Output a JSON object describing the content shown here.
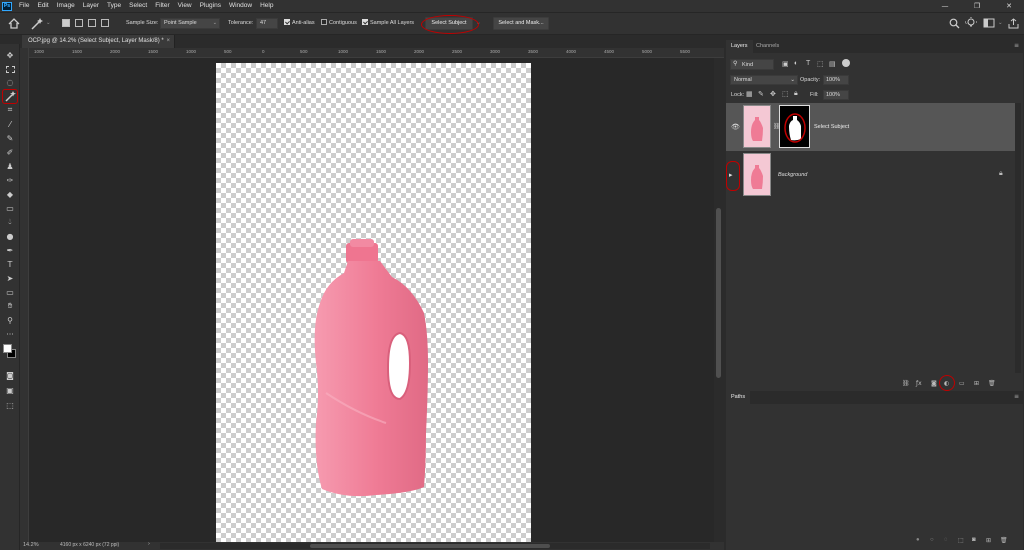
{
  "app": {
    "logo": "Ps"
  },
  "menu": [
    "File",
    "Edit",
    "Image",
    "Layer",
    "Type",
    "Select",
    "Filter",
    "View",
    "Plugins",
    "Window",
    "Help"
  ],
  "window_controls": {
    "minimize": "—",
    "restore": "❐",
    "close": "✕"
  },
  "options": {
    "sample_size_label": "Sample Size:",
    "sample_size_value": "Point Sample",
    "tolerance_label": "Tolerance:",
    "tolerance_value": "47",
    "anti_alias_label": "Anti-alias",
    "anti_alias_checked": true,
    "contiguous_label": "Contiguous",
    "contiguous_checked": false,
    "sample_all_layers_label": "Sample All Layers",
    "sample_all_layers_checked": true,
    "select_subject_label": "Select Subject",
    "select_and_mask_label": "Select and Mask..."
  },
  "document": {
    "tab_title": "OCP.jpg @ 14.2% (Select Subject, Layer Mask/8) *",
    "close_glyph": "×",
    "zoom": "14.2%",
    "dimensions": "4160 px x 6240 px (72 ppi)"
  },
  "ruler_ticks": [
    "1000",
    "1500",
    "2000",
    "1500",
    "1000",
    "500",
    "0",
    "500",
    "1000",
    "1500",
    "2000",
    "2500",
    "3000",
    "3500",
    "4000",
    "4500",
    "5000",
    "5500"
  ],
  "panels": {
    "layers_tab": "Layers",
    "channels_tab": "Channels",
    "paths_tab": "Paths",
    "filter_kind": "Kind",
    "blend_mode": "Normal",
    "opacity_label": "Opacity:",
    "opacity_value": "100%",
    "lock_label": "Lock:",
    "fill_label": "Fill:",
    "fill_value": "100%",
    "layers": [
      {
        "name": "Select Subject",
        "visible": true,
        "selected": true
      },
      {
        "name": "Background",
        "visible": false,
        "selected": false
      }
    ]
  },
  "colors": {
    "bottle": "#f07e99",
    "annotation": "#c00000",
    "foreground": "#ffffff",
    "background": "#000000"
  }
}
